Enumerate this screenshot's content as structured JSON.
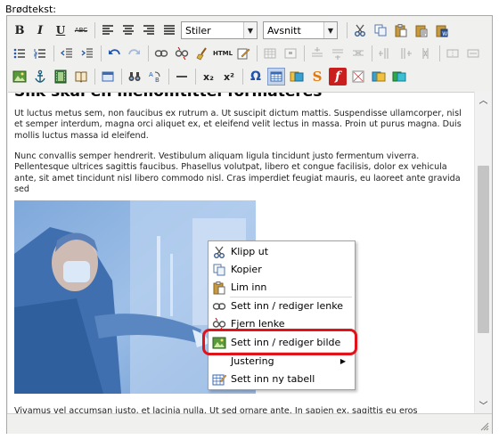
{
  "field_label": "Brødtekst:",
  "toolbar": {
    "bold": "B",
    "italic": "I",
    "underline": "U",
    "strikethrough": "ABC",
    "styles_select": "Stiler",
    "paragraph_select": "Avsnitt",
    "html_label": "HTML",
    "subscript": "x₂",
    "superscript": "x²",
    "omega": "Ω",
    "flash_label": "f",
    "s_label": "S"
  },
  "content": {
    "heading": "Slik skal en mellomtittel formateres",
    "para1": "Ut luctus metus sem, non faucibus ex rutrum a. Ut suscipit dictum mattis. Suspendisse ullamcorper, nisl et semper interdum, magna orci aliquet ex, et eleifend velit lectus in massa. Proin ut purus magna. Duis mollis luctus massa id eleifend.",
    "para2": "Nunc convallis semper hendrerit. Vestibulum aliquam ligula tincidunt justo fermentum viverra. Pellentesque ultrices sagittis faucibus. Phasellus volutpat, libero et congue facilisis, dolor ex vehicula ante, sit amet tincidunt nisl libero commodo nisl. Cras imperdiet feugiat mauris, eu laoreet ante gravida sed",
    "para3": "Vivamus vel accumsan justo, et lacinia nulla. Ut sed ornare ante. In sapien ex, sagittis eu eros"
  },
  "context_menu": {
    "cut": "Klipp ut",
    "copy": "Kopier",
    "paste": "Lim inn",
    "insert_link": "Sett inn / rediger lenke",
    "remove_link": "Fjern lenke",
    "insert_image": "Sett inn / rediger bilde",
    "align": "Justering",
    "insert_table": "Sett inn ny tabell"
  },
  "colors": {
    "highlight": "#e0121a",
    "toolbar_bg": "#f0f0ee",
    "photo_tint": "#5a8fd0"
  }
}
